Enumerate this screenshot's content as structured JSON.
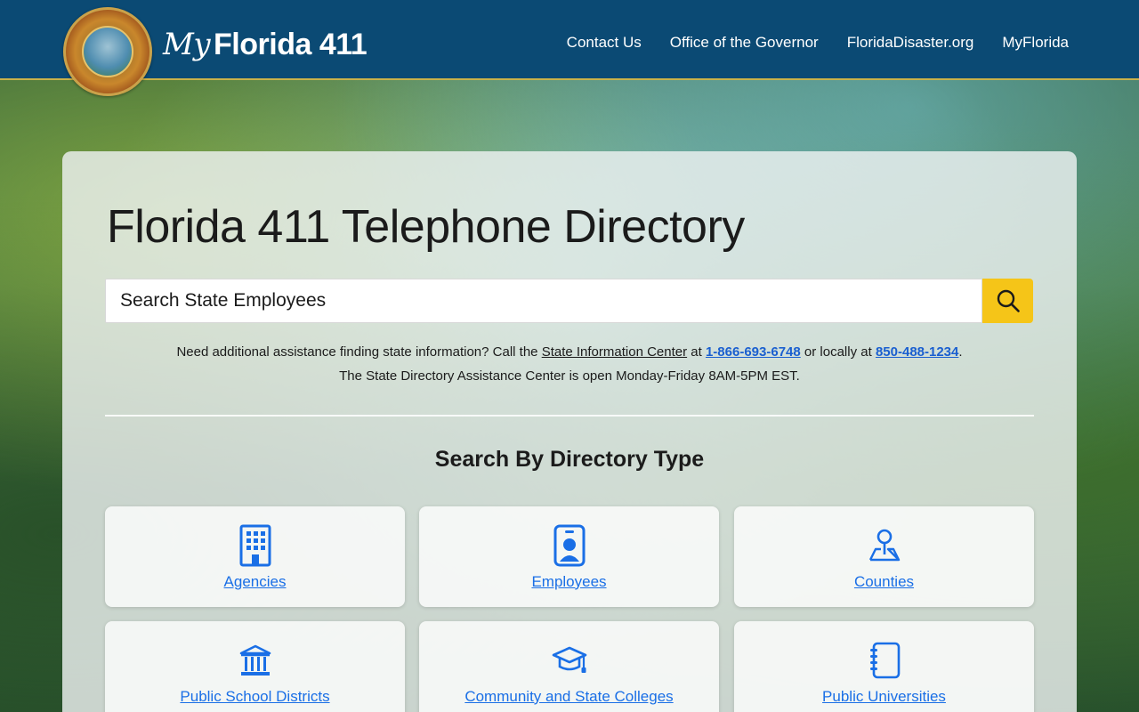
{
  "header": {
    "logo_my": "My",
    "logo_text": "Florida 411",
    "nav": [
      "Contact Us",
      "Office of the Governor",
      "FloridaDisaster.org",
      "MyFlorida"
    ]
  },
  "main": {
    "title": "Florida 411 Telephone Directory",
    "search": {
      "placeholder": "Search State Employees",
      "value": ""
    },
    "assist": {
      "line1_prefix": "Need additional assistance finding state information? Call the",
      "info_center_link": "State Information Center",
      "at": "at",
      "phone1": "1-866-693-6748",
      "or_locally": "or locally at",
      "phone2": "850-488-1234",
      "period": ".",
      "line2": "The State Directory Assistance Center is open Monday-Friday 8AM-5PM EST."
    },
    "section_title": "Search By Directory Type",
    "cards": [
      {
        "label": "Agencies",
        "icon": "building-icon"
      },
      {
        "label": "Employees",
        "icon": "id-badge-icon"
      },
      {
        "label": "Counties",
        "icon": "map-pin-icon"
      },
      {
        "label": "Public School Districts",
        "icon": "institution-icon"
      },
      {
        "label": "Community and State Colleges",
        "icon": "graduation-cap-icon"
      },
      {
        "label": "Public Universities",
        "icon": "notebook-icon"
      }
    ]
  },
  "colors": {
    "header_bg": "#0b4a74",
    "search_button": "#f5c518",
    "link_blue": "#1a6fe6"
  }
}
